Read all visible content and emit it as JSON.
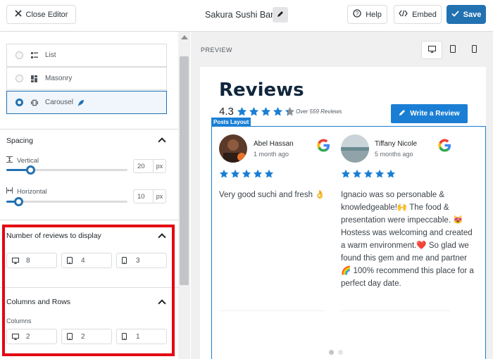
{
  "topbar": {
    "close_label": "Close Editor",
    "site_title": "Sakura Sushi Bar",
    "help_label": "Help",
    "embed_label": "Embed",
    "save_label": "Save"
  },
  "sidebar": {
    "layouts": [
      {
        "label": "List",
        "selected": false,
        "icon": "list-icon"
      },
      {
        "label": "Masonry",
        "selected": false,
        "icon": "masonry-icon"
      },
      {
        "label": "Carousel",
        "selected": true,
        "icon": "carousel-icon"
      }
    ],
    "spacing": {
      "title": "Spacing",
      "vertical_label": "Vertical",
      "vertical_value": "20",
      "horizontal_label": "Horizontal",
      "horizontal_value": "10",
      "unit": "px"
    },
    "num_reviews": {
      "title": "Number of reviews to display",
      "desktop": "8",
      "tablet": "4",
      "mobile": "3"
    },
    "columns_rows": {
      "title": "Columns and Rows",
      "columns_label": "Columns",
      "desktop": "2",
      "tablet": "2",
      "mobile": "1"
    }
  },
  "preview": {
    "label": "PREVIEW",
    "heading": "Reviews",
    "rating": "4.3",
    "rating_stars": 4.3,
    "over_text": "Over 559 Reviews",
    "write_review_label": "Write a Review",
    "posts_tag": "Posts Layout",
    "reviews": [
      {
        "name": "Abel Hassan",
        "time": "1 month ago",
        "stars": 5,
        "text": "Very good suchi and fresh 👌"
      },
      {
        "name": "Tiffany Nicole",
        "time": "5 months ago",
        "stars": 5,
        "text": "Ignacio was so personable & knowledgeable!🙌 The food & presentation were impeccable. 😻 Hostess was welcoming and created a warm environment.❤️ So glad we found this gem and me and partner 🌈 100% recommend this place for a perfect day date."
      }
    ]
  },
  "colors": {
    "accent": "#2271b1",
    "star": "#1a7fd4",
    "highlight_box": "#e30613"
  }
}
